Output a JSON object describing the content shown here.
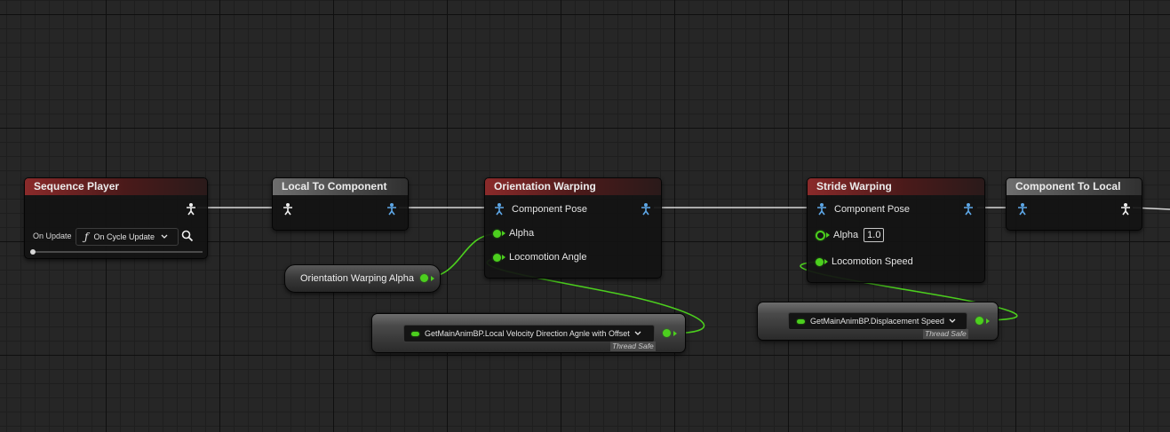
{
  "colors": {
    "float_pin": "#4ccf1e",
    "pose_pin": "#5ea8e8",
    "header_red": "#8a2a2a",
    "header_gray": "#6e6e6e"
  },
  "nodes": {
    "sequence_player": {
      "title": "Sequence Player",
      "on_update_label": "On Update",
      "function_icon": "ƒ",
      "on_update_value": "On Cycle Update"
    },
    "local_to_component": {
      "title": "Local To Component"
    },
    "orientation_warping": {
      "title": "Orientation Warping",
      "pins": [
        "Component Pose",
        "Alpha",
        "Locomotion Angle"
      ]
    },
    "stride_warping": {
      "title": "Stride Warping",
      "pins": [
        "Component Pose",
        "Alpha",
        "Locomotion Speed"
      ],
      "alpha_value": "1.0"
    },
    "component_to_local": {
      "title": "Component To Local"
    }
  },
  "variable_node": {
    "label": "Orientation Warping Alpha"
  },
  "function_nodes": [
    {
      "label": "GetMainAnimBP.Local Velocity Direction Agnle with Offset",
      "badge": "Thread Safe"
    },
    {
      "label": "GetMainAnimBP.Displacement Speed",
      "badge": "Thread Safe"
    }
  ]
}
